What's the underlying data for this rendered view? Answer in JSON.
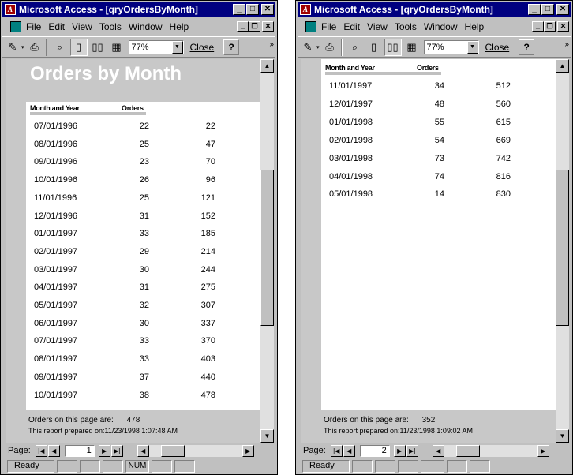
{
  "left": {
    "title": "Microsoft Access - [qryOrdersByMonth]",
    "menu": [
      "File",
      "Edit",
      "View",
      "Tools",
      "Window",
      "Help"
    ],
    "zoom": "77%",
    "close_label": "Close",
    "report_title": "Orders by Month",
    "col_month": "Month and Year",
    "col_orders": "Orders",
    "rows": [
      {
        "date": "07/01/1996",
        "orders": "22",
        "running": "22"
      },
      {
        "date": "08/01/1996",
        "orders": "25",
        "running": "47"
      },
      {
        "date": "09/01/1996",
        "orders": "23",
        "running": "70"
      },
      {
        "date": "10/01/1996",
        "orders": "26",
        "running": "96"
      },
      {
        "date": "11/01/1996",
        "orders": "25",
        "running": "121"
      },
      {
        "date": "12/01/1996",
        "orders": "31",
        "running": "152"
      },
      {
        "date": "01/01/1997",
        "orders": "33",
        "running": "185"
      },
      {
        "date": "02/01/1997",
        "orders": "29",
        "running": "214"
      },
      {
        "date": "03/01/1997",
        "orders": "30",
        "running": "244"
      },
      {
        "date": "04/01/1997",
        "orders": "31",
        "running": "275"
      },
      {
        "date": "05/01/1997",
        "orders": "32",
        "running": "307"
      },
      {
        "date": "06/01/1997",
        "orders": "30",
        "running": "337"
      },
      {
        "date": "07/01/1997",
        "orders": "33",
        "running": "370"
      },
      {
        "date": "08/01/1997",
        "orders": "33",
        "running": "403"
      },
      {
        "date": "09/01/1997",
        "orders": "37",
        "running": "440"
      },
      {
        "date": "10/01/1997",
        "orders": "38",
        "running": "478"
      }
    ],
    "footer_label": "Orders on this page are:",
    "footer_value": "478",
    "prepared": "This report prepared on:11/23/1998 1:07:48 AM",
    "page_label": "Page:",
    "page_num": "1",
    "status": "Ready",
    "num": "NUM"
  },
  "right": {
    "title": "Microsoft Access - [qryOrdersByMonth]",
    "menu": [
      "File",
      "Edit",
      "View",
      "Tools",
      "Window",
      "Help"
    ],
    "zoom": "77%",
    "close_label": "Close",
    "col_month": "Month and Year",
    "col_orders": "Orders",
    "rows": [
      {
        "date": "11/01/1997",
        "orders": "34",
        "running": "512"
      },
      {
        "date": "12/01/1997",
        "orders": "48",
        "running": "560"
      },
      {
        "date": "01/01/1998",
        "orders": "55",
        "running": "615"
      },
      {
        "date": "02/01/1998",
        "orders": "54",
        "running": "669"
      },
      {
        "date": "03/01/1998",
        "orders": "73",
        "running": "742"
      },
      {
        "date": "04/01/1998",
        "orders": "74",
        "running": "816"
      },
      {
        "date": "05/01/1998",
        "orders": "14",
        "running": "830"
      }
    ],
    "footer_label": "Orders on this page are:",
    "footer_value": "352",
    "prepared": "This report prepared on:11/23/1998 1:09:02 AM",
    "page_label": "Page:",
    "page_num": "2",
    "status": "Ready"
  },
  "colors": {
    "title_bar": "#000080",
    "report_band": "#c8c8c8",
    "window": "#c0c0c0"
  }
}
